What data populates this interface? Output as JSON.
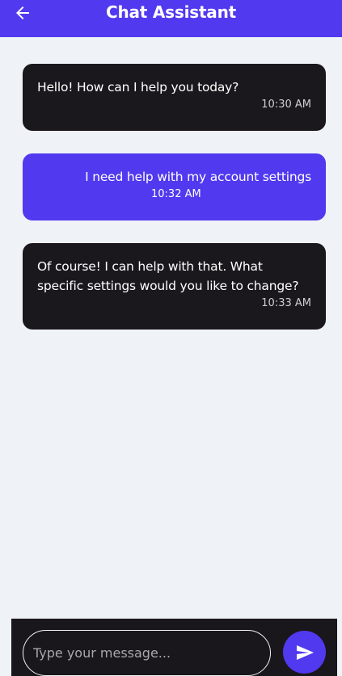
{
  "header": {
    "title": "Chat Assistant"
  },
  "messages": [
    {
      "sender": "bot",
      "text": "Hello! How can I help you today?",
      "time": "10:30 AM"
    },
    {
      "sender": "user",
      "text": "I need help with my account settings",
      "time": "10:32 AM"
    },
    {
      "sender": "bot",
      "text": "Of course! I can help with that. What specific settings would you like to change?",
      "time": "10:33 AM"
    }
  ],
  "composer": {
    "placeholder": "Type your message...",
    "value": ""
  },
  "colors": {
    "accent": "#5139ef",
    "bubble_dark": "#1a181c",
    "background": "#eff2f7"
  },
  "icons": {
    "back": "arrow-left-icon",
    "send": "send-icon"
  }
}
